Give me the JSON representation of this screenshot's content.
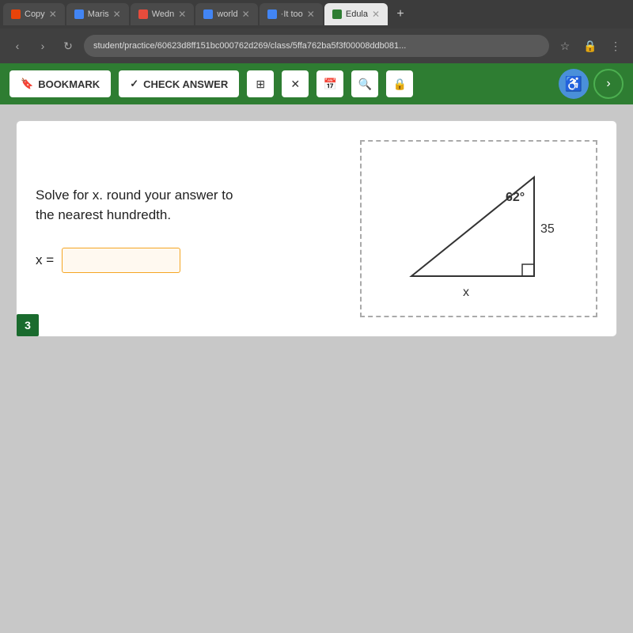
{
  "browser": {
    "tabs": [
      {
        "id": "copy",
        "label": "Copy",
        "icon_color": "#e8440a",
        "active": false
      },
      {
        "id": "maris",
        "label": "Maris",
        "icon_color": "#4285f4",
        "active": false
      },
      {
        "id": "wedn",
        "label": "Wedn",
        "icon_color": "#e74c3c",
        "active": false
      },
      {
        "id": "world",
        "label": "world",
        "icon_color": "#4285f4",
        "active": false
      },
      {
        "id": "ittoo",
        "label": "·It too",
        "icon_color": "#4285f4",
        "active": false
      },
      {
        "id": "edula",
        "label": "Edula",
        "icon_color": "#2e7d32",
        "active": true
      }
    ],
    "url": "student/practice/60623d8ff151bc000762d269/class/5ffa762ba5f3f00008ddb081..."
  },
  "toolbar": {
    "bookmark_label": "BOOKMARK",
    "check_answer_label": "CHECK ANSWER",
    "check_icon": "✓",
    "bookmark_icon": "🔖"
  },
  "question": {
    "number": "3",
    "text_line1": "Solve for x. round your answer to",
    "text_line2": "the nearest hundredth.",
    "answer_label": "x =",
    "answer_placeholder": "",
    "angle_value": "62°",
    "side_label": "35",
    "bottom_label": "x"
  }
}
